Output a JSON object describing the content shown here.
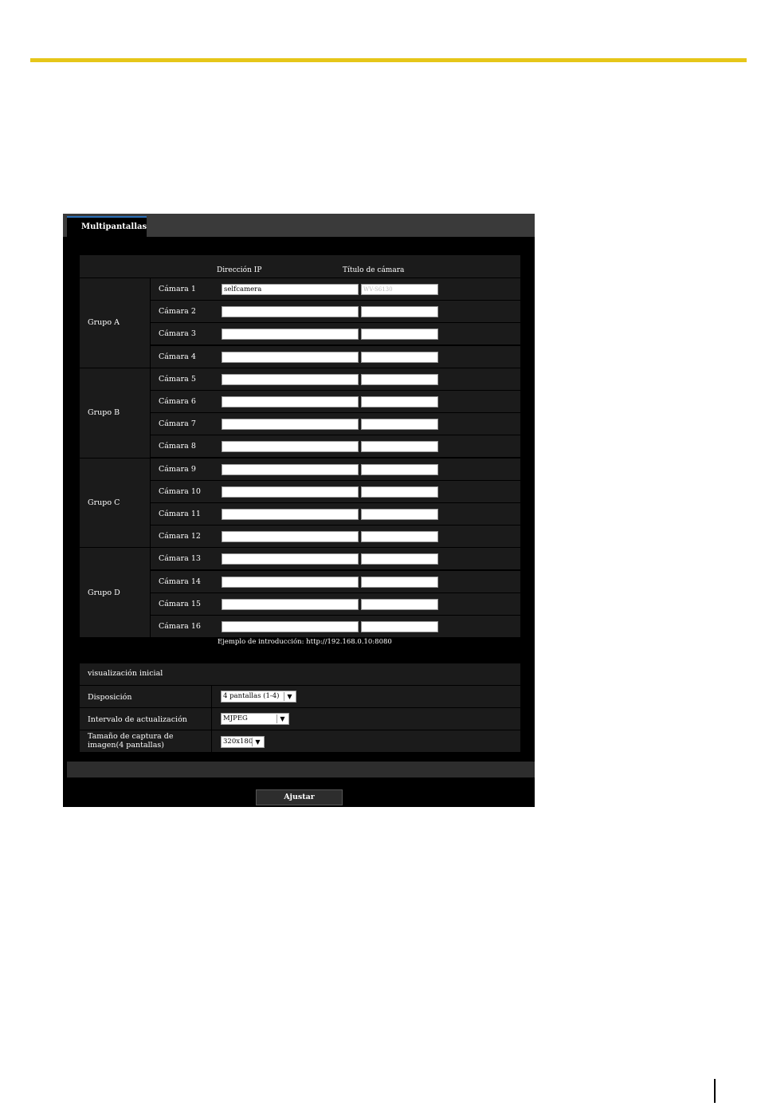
{
  "tab": {
    "label": "Multipantallas"
  },
  "columns": {
    "ip": "Dirección IP",
    "title": "Título de cámara"
  },
  "groups": [
    {
      "label": "Grupo A",
      "cameras": [
        {
          "label": "Cámara 1",
          "ip": "selfcamera",
          "title": "WV-S6130"
        },
        {
          "label": "Cámara 2",
          "ip": "",
          "title": ""
        },
        {
          "label": "Cámara 3",
          "ip": "",
          "title": ""
        },
        {
          "label": "Cámara 4",
          "ip": "",
          "title": ""
        }
      ]
    },
    {
      "label": "Grupo B",
      "cameras": [
        {
          "label": "Cámara 5",
          "ip": "",
          "title": ""
        },
        {
          "label": "Cámara 6",
          "ip": "",
          "title": ""
        },
        {
          "label": "Cámara 7",
          "ip": "",
          "title": ""
        },
        {
          "label": "Cámara 8",
          "ip": "",
          "title": ""
        }
      ]
    },
    {
      "label": "Grupo C",
      "cameras": [
        {
          "label": "Cámara 9",
          "ip": "",
          "title": ""
        },
        {
          "label": "Cámara 10",
          "ip": "",
          "title": ""
        },
        {
          "label": "Cámara 11",
          "ip": "",
          "title": ""
        },
        {
          "label": "Cámara 12",
          "ip": "",
          "title": ""
        }
      ]
    },
    {
      "label": "Grupo D",
      "cameras": [
        {
          "label": "Cámara 13",
          "ip": "",
          "title": ""
        },
        {
          "label": "Cámara 14",
          "ip": "",
          "title": ""
        },
        {
          "label": "Cámara 15",
          "ip": "",
          "title": ""
        },
        {
          "label": "Cámara 16",
          "ip": "",
          "title": ""
        }
      ]
    }
  ],
  "example": "Ejemplo de introducción: http://192.168.0.10:8080",
  "initial": {
    "heading": "visualización inicial",
    "layout": {
      "label": "Disposición",
      "value": "4 pantallas (1-4)"
    },
    "refresh": {
      "label": "Intervalo de actualización",
      "value": "MJPEG"
    },
    "capture": {
      "label": "Tamaño de captura de imagen(4 pantallas)",
      "value": "320x180"
    }
  },
  "apply_label": "Ajustar",
  "colors": {
    "accent_rule": "#e6c619",
    "tab_indicator": "#2a6fb8",
    "panel_bg": "#000000",
    "row_bg": "#1b1b1b"
  }
}
